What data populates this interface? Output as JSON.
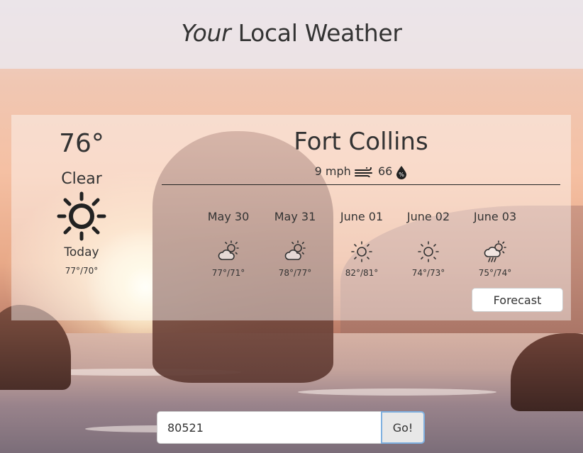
{
  "header": {
    "title_em": "Your",
    "title_rest": " Local Weather"
  },
  "current": {
    "temp": "76°",
    "condition": "Clear",
    "condition_icon": "sun-icon",
    "day": "Today",
    "range": "77°/70°"
  },
  "location": {
    "city": "Fort Collins",
    "wind": "9 mph",
    "wind_icon": "wind-icon",
    "humidity": "66",
    "humidity_icon": "humidity-drop-icon"
  },
  "forecast": [
    {
      "date": "May 30",
      "icon": "partly-cloudy-day-icon",
      "range": "77°/71°"
    },
    {
      "date": "May 31",
      "icon": "partly-cloudy-day-icon",
      "range": "78°/77°"
    },
    {
      "date": "June 01",
      "icon": "sun-icon",
      "range": "82°/81°"
    },
    {
      "date": "June 02",
      "icon": "sun-icon",
      "range": "74°/73°"
    },
    {
      "date": "June 03",
      "icon": "rain-sun-icon",
      "range": "75°/74°"
    }
  ],
  "forecast_button": "Forecast",
  "search": {
    "value": "80521",
    "button": "Go!"
  }
}
